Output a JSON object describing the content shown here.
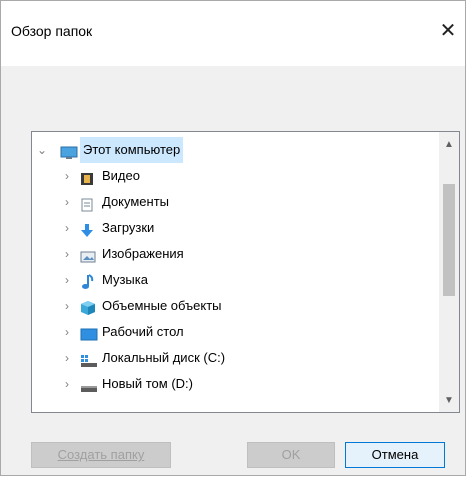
{
  "window": {
    "title": "Обзор папок",
    "close_glyph": "✕"
  },
  "tree": {
    "root": {
      "label": "Этот компьютер",
      "icon": "monitor-icon",
      "expanded": true,
      "selected": true
    },
    "items": [
      {
        "label": "Видео",
        "icon": "video-film-icon"
      },
      {
        "label": "Документы",
        "icon": "document-icon"
      },
      {
        "label": "Загрузки",
        "icon": "download-arrow-icon"
      },
      {
        "label": "Изображения",
        "icon": "pictures-icon"
      },
      {
        "label": "Музыка",
        "icon": "music-note-icon"
      },
      {
        "label": "Объемные объекты",
        "icon": "3d-objects-icon"
      },
      {
        "label": "Рабочий стол",
        "icon": "desktop-icon"
      },
      {
        "label": "Локальный диск (C:)",
        "icon": "system-drive-icon"
      },
      {
        "label": "Новый том (D:)",
        "icon": "drive-icon"
      }
    ]
  },
  "buttons": {
    "new_folder": "Создать папку",
    "ok": "OK",
    "cancel": "Отмена"
  },
  "colors": {
    "selection": "#cce8ff",
    "accent": "#0078d7",
    "tree_border": "#828790"
  }
}
